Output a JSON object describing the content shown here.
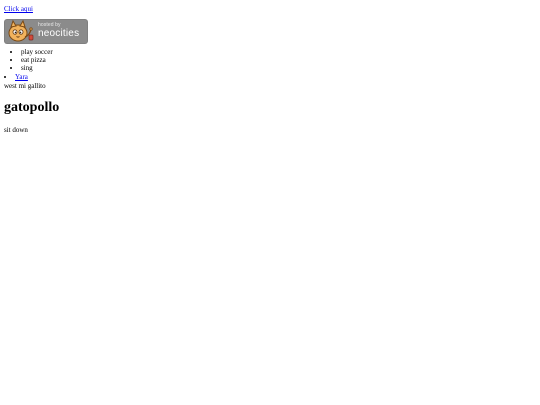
{
  "links": {
    "click_here": "Click aqui",
    "yara": "Yara"
  },
  "badge": {
    "small_text": "hosted by",
    "main_text": "neocities",
    "icon": "cat-icon"
  },
  "activities": [
    "play soccer",
    "eat pizza",
    "sing"
  ],
  "page": {
    "subtitle": "west mi gallito",
    "heading": "gatopollo",
    "footer_text": "sit down"
  },
  "colors": {
    "link": "#0000ee",
    "badge_bg": "#8b8b8b",
    "text": "#000000",
    "background": "#ffffff"
  }
}
